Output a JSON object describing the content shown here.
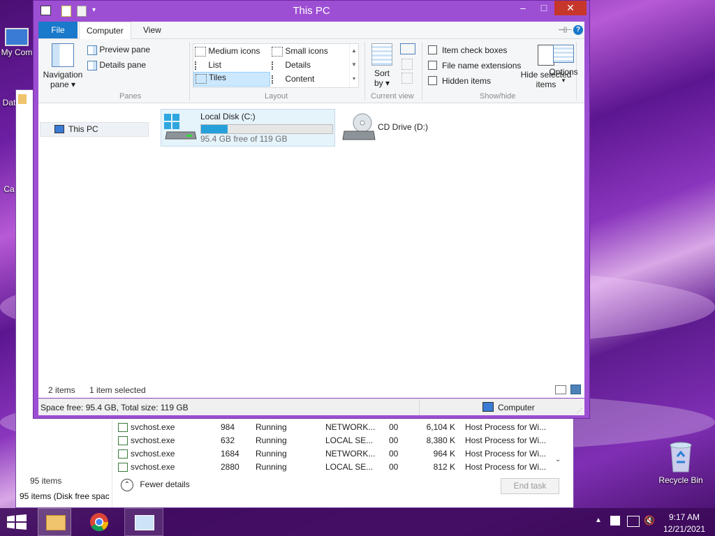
{
  "desktop": {
    "icons": [
      {
        "label": "My Com"
      },
      {
        "label": "Dat"
      },
      {
        "label": "Ca"
      },
      {
        "label": "Recycle Bin"
      }
    ]
  },
  "task_manager": {
    "rows": [
      {
        "name": "svchost.exe",
        "pid": "984",
        "status": "Running",
        "user": "NETWORK...",
        "cpu": "00",
        "mem": "6,104 K",
        "desc": "Host Process for Wi..."
      },
      {
        "name": "svchost.exe",
        "pid": "632",
        "status": "Running",
        "user": "LOCAL SE...",
        "cpu": "00",
        "mem": "8,380 K",
        "desc": "Host Process for Wi..."
      },
      {
        "name": "svchost.exe",
        "pid": "1684",
        "status": "Running",
        "user": "NETWORK...",
        "cpu": "00",
        "mem": "964 K",
        "desc": "Host Process for Wi..."
      },
      {
        "name": "svchost.exe",
        "pid": "2880",
        "status": "Running",
        "user": "LOCAL SE...",
        "cpu": "00",
        "mem": "812 K",
        "desc": "Host Process for Wi..."
      }
    ],
    "items_count": "95 items",
    "status_text": "95 items (Disk free spac",
    "fewer_details": "Fewer details",
    "end_task": "End task"
  },
  "explorer": {
    "title": "This PC",
    "tabs": [
      "File",
      "Computer",
      "View"
    ],
    "ribbon": {
      "panes": {
        "navigation_pane": "Navigation",
        "navigation_pane_2": "pane",
        "preview_pane": "Preview pane",
        "details_pane": "Details pane",
        "label": "Panes"
      },
      "layout": {
        "items": [
          "Medium icons",
          "Small icons",
          "List",
          "Details",
          "Tiles",
          "Content"
        ],
        "selected": "Tiles",
        "label": "Layout"
      },
      "current_view": {
        "sort_by": "Sort",
        "sort_by_2": "by",
        "label": "Current view"
      },
      "show_hide": {
        "item_check_boxes": "Item check boxes",
        "file_name_extensions": "File name extensions",
        "hidden_items": "Hidden items",
        "hide_selected": "Hide selected",
        "hide_selected_2": "items",
        "label": "Show/hide"
      },
      "options": "Options"
    },
    "nav": {
      "this_pc": "This PC"
    },
    "drives": [
      {
        "name": "Local Disk (C:)",
        "free": "95.4 GB free of 119 GB",
        "used_fraction": 0.2
      },
      {
        "name": "CD Drive (D:)"
      }
    ],
    "status": {
      "items": "2 items",
      "selected": "1 item selected"
    },
    "details_bar": {
      "space": "Space free: 95.4 GB, Total size: 119 GB",
      "location": "Computer"
    }
  },
  "taskbar": {
    "time": "9:17 AM",
    "date": "12/21/2021"
  },
  "colors": {
    "window_frame": "#9d4fd3",
    "file_tab": "#1979ca",
    "selection": "#cce8ff",
    "drive_bar": "#26a0da"
  }
}
